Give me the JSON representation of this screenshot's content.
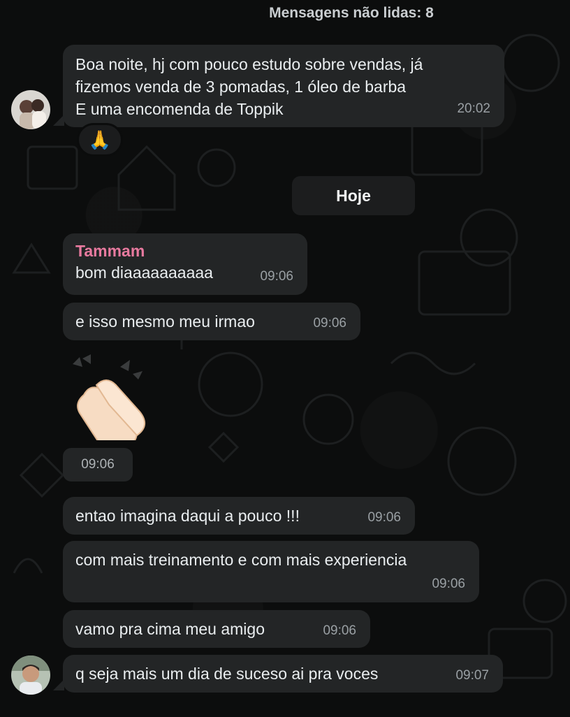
{
  "unread_banner": "Mensagens não lidas: 8",
  "date_divider": "Hoje",
  "messages": [
    {
      "text": "Boa noite, hj com pouco estudo sobre vendas, já\nfizemos venda de 3 pomadas, 1 óleo de barba\nE uma encomenda de Toppik",
      "time": "20:02",
      "reaction": "🙏"
    },
    {
      "sender": "Tammam",
      "text": "bom diaaaaaaaaaa",
      "time": "09:06"
    },
    {
      "text": "e isso mesmo meu irmao",
      "time": "09:06"
    },
    {
      "sticker": "👏",
      "time": "09:06"
    },
    {
      "text": "entao imagina daqui a pouco !!!",
      "time": "09:06"
    },
    {
      "text": "com mais treinamento e com mais experiencia",
      "time": "09:06"
    },
    {
      "text": "vamo pra cima meu amigo",
      "time": "09:06"
    },
    {
      "text": "q seja mais um dia de suceso ai pra voces",
      "time": "09:07"
    }
  ],
  "colors": {
    "background": "#0c0d0d",
    "bubble": "#232526",
    "sender_name": "#e87a9f",
    "timestamp": "#9aa0a4"
  }
}
